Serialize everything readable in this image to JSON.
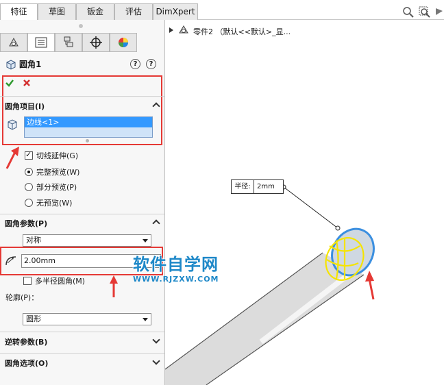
{
  "tabs": [
    "特征",
    "草图",
    "钣金",
    "评估",
    "DimXpert"
  ],
  "feature": {
    "title": "圆角1",
    "ok_icon": "checkmark-icon",
    "cancel_icon": "close-icon"
  },
  "fillet_items": {
    "header": "圆角项目(I)",
    "list": [
      "边线<1>"
    ]
  },
  "options": {
    "tangent_propagation": "切线延伸(G)",
    "full_preview": "完整预览(W)",
    "partial_preview": "部分预览(P)",
    "no_preview": "无预览(W)"
  },
  "fillet_params": {
    "header": "圆角参数(P)",
    "type": "对称",
    "radius": "2.00mm",
    "multi_radius": "多半径圆角(M)",
    "profile_label": "轮廓(P)：",
    "profile": "圆形"
  },
  "collapsed_sections": [
    "逆转参数(B)",
    "圆角选项(O)"
  ],
  "tree": {
    "item": "零件2 （默认<<默认>_显..."
  },
  "callout": {
    "label": "半径:",
    "value": "2mm"
  },
  "watermark": {
    "main": "软件自学网",
    "sub": "WWW.RJZXW.COM"
  },
  "colors": {
    "accent_red": "#e53935",
    "highlight_blue": "#3399ff",
    "edge_yellow": "#f5e400"
  }
}
